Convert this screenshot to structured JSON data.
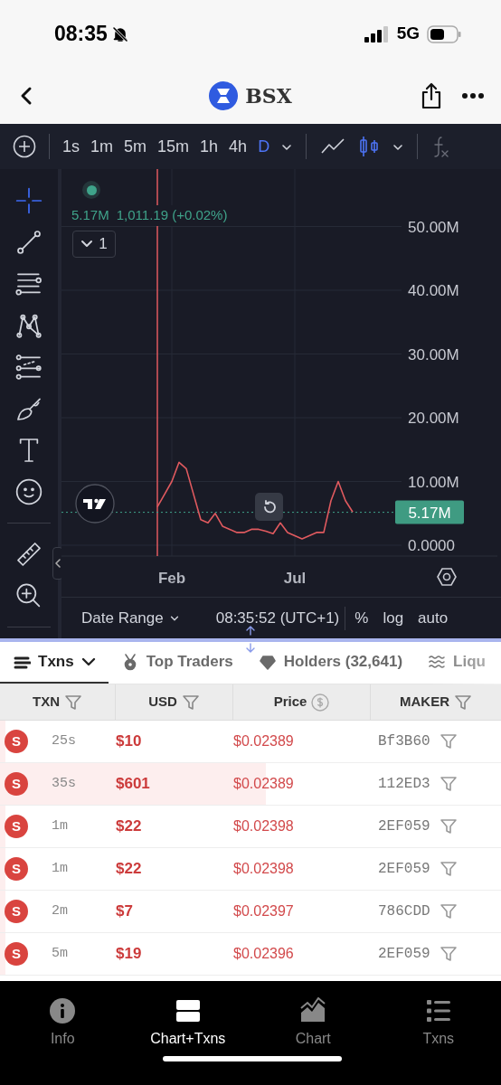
{
  "status_bar": {
    "time": "08:35",
    "network": "5G"
  },
  "header": {
    "title": "BSX"
  },
  "toolbar": {
    "intervals": [
      {
        "label": "1s",
        "selected": false
      },
      {
        "label": "1m",
        "selected": false
      },
      {
        "label": "5m",
        "selected": false
      },
      {
        "label": "15m",
        "selected": false
      },
      {
        "label": "1h",
        "selected": false
      },
      {
        "label": "4h",
        "selected": false
      },
      {
        "label": "D",
        "selected": true
      }
    ],
    "chart_styles": [
      {
        "kind": "line",
        "selected": false
      },
      {
        "kind": "candles",
        "selected": true
      }
    ]
  },
  "drawing_tools": {
    "groups": [
      {
        "tools": [
          {
            "kind": "crosshair",
            "selected": true
          },
          {
            "kind": "trend-line",
            "selected": false
          },
          {
            "kind": "parallel-lines",
            "selected": false
          },
          {
            "kind": "pattern",
            "selected": false
          },
          {
            "kind": "fib",
            "selected": false
          },
          {
            "kind": "brush",
            "selected": false
          },
          {
            "kind": "text",
            "selected": false
          },
          {
            "kind": "emoji",
            "selected": false
          }
        ]
      },
      {
        "tools": [
          {
            "kind": "ruler",
            "selected": false
          },
          {
            "kind": "zoom",
            "selected": false
          }
        ]
      }
    ]
  },
  "chart": {
    "legend": {
      "volume": "5.17M",
      "value": "1,011.19 (+0.02%)"
    },
    "indicator_count": "1",
    "last_price": "5.17M",
    "chart_data": {
      "type": "line",
      "categories": [
        null,
        null,
        "Feb",
        null,
        null,
        null,
        null,
        null,
        null,
        null,
        null,
        null,
        null,
        null,
        null,
        null,
        null,
        null,
        null,
        "Jul",
        null,
        null,
        null,
        null,
        null,
        null,
        null,
        null
      ],
      "series": [
        {
          "color": "#e05a5f",
          "values": [
            6,
            8,
            10,
            13,
            12,
            8,
            4,
            3.5,
            5,
            3,
            2.5,
            2,
            2,
            2.5,
            2.5,
            2.2,
            1.8,
            3.5,
            2,
            1.5,
            1,
            1.5,
            2,
            2,
            7,
            10,
            7,
            5.2
          ]
        }
      ],
      "ylim": [
        -1.7,
        59
      ],
      "grid": true,
      "ref_lines": [
        {
          "axis": "y",
          "value": 5.17,
          "color": "#3fa38a"
        }
      ],
      "yticks": [
        {
          "value": 0,
          "label": "0.0000"
        },
        {
          "value": 10,
          "label": "10.00M"
        },
        {
          "value": 20,
          "label": "20.00M"
        },
        {
          "value": 30,
          "label": "30.00M"
        },
        {
          "value": 40,
          "label": "40.00M"
        },
        {
          "value": 50,
          "label": "50.00M"
        }
      ]
    },
    "date_range": "Date Range",
    "time": "08:35:52 (UTC+1)",
    "scale_options": [
      "%",
      "log",
      "auto"
    ]
  },
  "tabs": [
    {
      "label": "Txns",
      "kind": "menu",
      "selected": true
    },
    {
      "label": "Top Traders",
      "kind": "medal",
      "selected": false
    },
    {
      "label": "Holders (32,641)",
      "kind": "diamond",
      "selected": false
    },
    {
      "label": "Liqu",
      "kind": "waves",
      "selected": false
    }
  ],
  "table": {
    "columns": [
      {
        "label": "TXN",
        "kind": "filter"
      },
      {
        "label": "USD",
        "kind": "filter"
      },
      {
        "label": "Price",
        "kind": "currency"
      },
      {
        "label": "MAKER",
        "kind": "filter"
      }
    ],
    "rows": [
      {
        "kind": "sell",
        "side": "S",
        "age": "25s",
        "usd": "$10",
        "price": "$0.02389",
        "maker": "Bf3B60",
        "level": 0.01
      },
      {
        "kind": "sell",
        "side": "S",
        "age": "35s",
        "usd": "$601",
        "price": "$0.02389",
        "maker": "112ED3",
        "level": 0.53
      },
      {
        "kind": "sell",
        "side": "S",
        "age": "1m",
        "usd": "$22",
        "price": "$0.02398",
        "maker": "2EF059",
        "level": 0.01
      },
      {
        "kind": "sell",
        "side": "S",
        "age": "1m",
        "usd": "$22",
        "price": "$0.02398",
        "maker": "2EF059",
        "level": 0.01
      },
      {
        "kind": "sell",
        "side": "S",
        "age": "2m",
        "usd": "$7",
        "price": "$0.02397",
        "maker": "786CDD",
        "level": 0.01
      },
      {
        "kind": "sell",
        "side": "S",
        "age": "5m",
        "usd": "$19",
        "price": "$0.02396",
        "maker": "2EF059",
        "level": 0.01
      }
    ]
  },
  "bottom_nav": [
    {
      "label": "Info",
      "kind": "info",
      "selected": false
    },
    {
      "label": "Chart+Txns",
      "kind": "split",
      "selected": true
    },
    {
      "label": "Chart",
      "kind": "chart",
      "selected": false
    },
    {
      "label": "Txns",
      "kind": "list",
      "selected": false
    }
  ]
}
